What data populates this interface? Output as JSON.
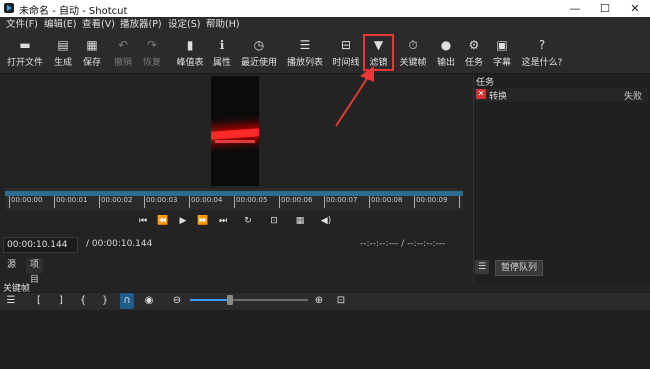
{
  "window": {
    "title": "未命名 - 自动 - Shotcut",
    "minimize": "—",
    "maximize": "☐",
    "close": "✕"
  },
  "menu": [
    "文件(F)",
    "编辑(E)",
    "查看(V)",
    "播放器(P)",
    "设定(S)",
    "帮助(H)"
  ],
  "toolbar": [
    {
      "label": "打开文件",
      "icon": "▬"
    },
    {
      "label": "生成",
      "icon": "▤"
    },
    {
      "label": "保存",
      "icon": "▦"
    },
    {
      "label": "撤销",
      "icon": "↶"
    },
    {
      "label": "恢复",
      "icon": "↷"
    },
    {
      "label": "峰值表",
      "icon": "▮"
    },
    {
      "label": "属性",
      "icon": "ℹ"
    },
    {
      "label": "最近使用",
      "icon": "◷"
    },
    {
      "label": "播放列表",
      "icon": "☰"
    },
    {
      "label": "时间线",
      "icon": "⊟"
    },
    {
      "label": "滤镜",
      "icon": "▼"
    },
    {
      "label": "关键帧",
      "icon": "⏱"
    },
    {
      "label": "输出",
      "icon": "●"
    },
    {
      "label": "任务",
      "icon": "⚙"
    },
    {
      "label": "字幕",
      "icon": "▣"
    },
    {
      "label": "这是什么?",
      "icon": "?"
    }
  ],
  "timeline": {
    "ticks": [
      "00:00:00",
      "00:00:01",
      "00:00:02",
      "00:00:03",
      "00:00:04",
      "00:00:05",
      "00:00:06",
      "00:00:07",
      "00:00:08",
      "00:00:09"
    ]
  },
  "transport": {
    "current_time": "00:00:10.144",
    "duration": "/ 00:00:10.144",
    "in_out": "--:--:--:--- / --:--:--:---"
  },
  "tabs": [
    "源",
    "项目"
  ],
  "tasks": {
    "heading": "任务",
    "items": [
      {
        "name": "转换",
        "status": "失败"
      }
    ],
    "menu_icon": "☰",
    "pause_label": "暂停队列"
  },
  "keyframes": {
    "heading": "关键帧"
  },
  "colors": {
    "accent": "#2a6f8f",
    "highlight": "#e53935",
    "error": "#d32f2f",
    "slider": "#3aa0ff"
  }
}
